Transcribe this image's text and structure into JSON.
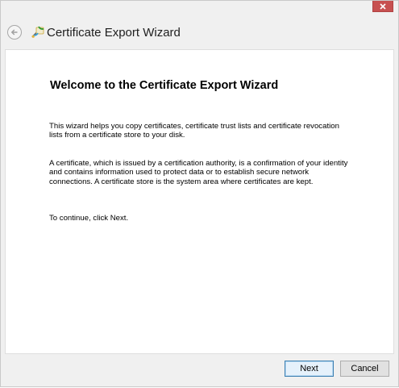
{
  "window": {
    "title": "Certificate Export Wizard",
    "close_icon": "close-icon",
    "back_icon": "back-arrow-icon",
    "title_icon": "certificate-wizard-icon"
  },
  "content": {
    "heading": "Welcome to the Certificate Export Wizard",
    "paragraph1": "This wizard helps you copy certificates, certificate trust lists and certificate revocation\nlists from a certificate store to your disk.",
    "paragraph2": "A certificate, which is issued by a certification authority, is a confirmation of your identity\nand contains information used to protect data or to establish secure network\nconnections. A certificate store is the system area where certificates are kept.",
    "paragraph3": "To continue, click Next."
  },
  "buttons": {
    "next": "Next",
    "cancel": "Cancel"
  },
  "colors": {
    "close_button": "#c75050",
    "default_button_border": "#3c7fb1",
    "window_background": "#f0f0f0",
    "content_background": "#ffffff"
  }
}
